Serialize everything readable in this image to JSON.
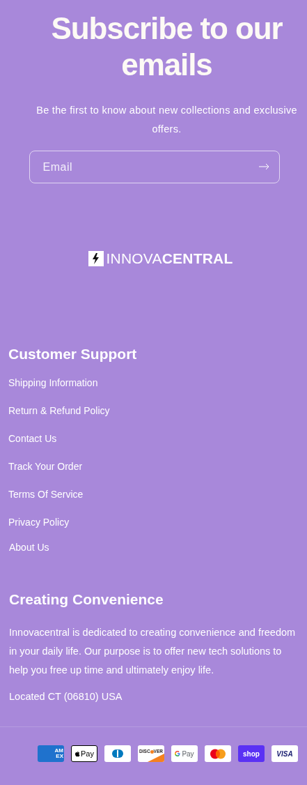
{
  "newsletter": {
    "title": "Subscribe to our emails",
    "description": "Be the first to know about new collections and exclusive offers.",
    "email_field": {
      "placeholder": "Email"
    }
  },
  "logo": {
    "light_text": "INNOVA",
    "bold_text": "CENTRAL"
  },
  "customer_support": {
    "title": "Customer Support",
    "links": [
      "Shipping Information",
      "Return & Refund Policy",
      "Contact Us",
      "Track Your Order",
      "Terms Of Service",
      "Privacy Policy",
      "About Us"
    ]
  },
  "about": {
    "title": "Creating Convenience",
    "text": "Innovacentral is dedicated to creating convenience and freedom in your daily life. Our purpose is to offer new tech solutions to help you free up time and ultimately enjoy life.",
    "location": "Located CT (06810) USA"
  },
  "payment_icons": [
    {
      "kind": "amex",
      "label": [
        "AM",
        "EX"
      ]
    },
    {
      "kind": "applepay",
      "label": [
        "Pay"
      ]
    },
    {
      "kind": "diners"
    },
    {
      "kind": "discover",
      "label": [
        "DISC",
        "VER"
      ]
    },
    {
      "kind": "googlepay",
      "label": [
        "Pay"
      ]
    },
    {
      "kind": "mastercard"
    },
    {
      "kind": "shoppay",
      "label": [
        "shop"
      ]
    },
    {
      "kind": "visa",
      "label": [
        "VISA"
      ]
    }
  ]
}
